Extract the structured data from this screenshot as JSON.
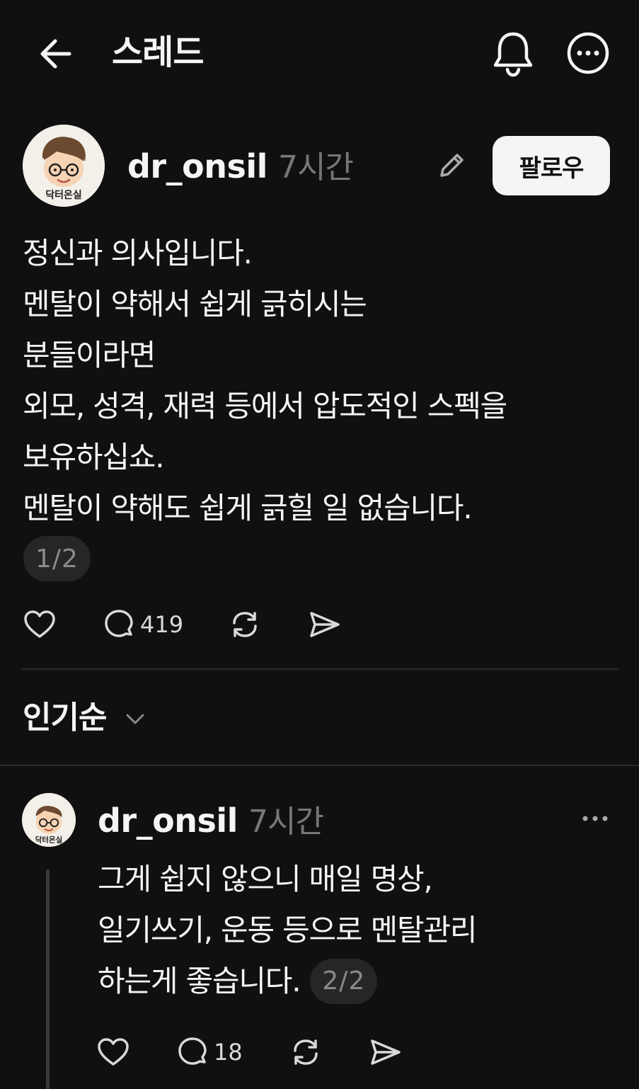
{
  "header": {
    "title": "스레드",
    "back_icon": "arrow-left-icon",
    "notify_icon": "bell-icon",
    "more_icon": "more-horizontal-circle-icon"
  },
  "post": {
    "avatar_text": "닥터온실",
    "username": "dr_onsil",
    "time": "7시간",
    "follow_label": "팔로우",
    "lines": [
      "정신과 의사입니다.",
      "멘탈이 약해서 쉽게 긁히시는",
      "분들이라면",
      "외모, 성격, 재력 등에서 압도적인 스펙을",
      "보유하십쇼.",
      "멘탈이 약해도 쉽게 긁힐 일 없습니다."
    ],
    "page_indicator": "1/2",
    "reply_count": "419"
  },
  "sort": {
    "label": "인기순"
  },
  "reply": {
    "avatar_text": "닥터온실",
    "username": "dr_onsil",
    "time": "7시간",
    "lines": [
      "그게 쉽지 않으니 매일 명상,",
      "일기쓰기, 운동 등으로 멘탈관리",
      "하는게 좋습니다."
    ],
    "page_indicator": "2/2",
    "reply_count": "18"
  },
  "colors": {
    "background": "#101010",
    "text": "#f3f5f7",
    "muted": "#777777",
    "pill": "#262626"
  }
}
